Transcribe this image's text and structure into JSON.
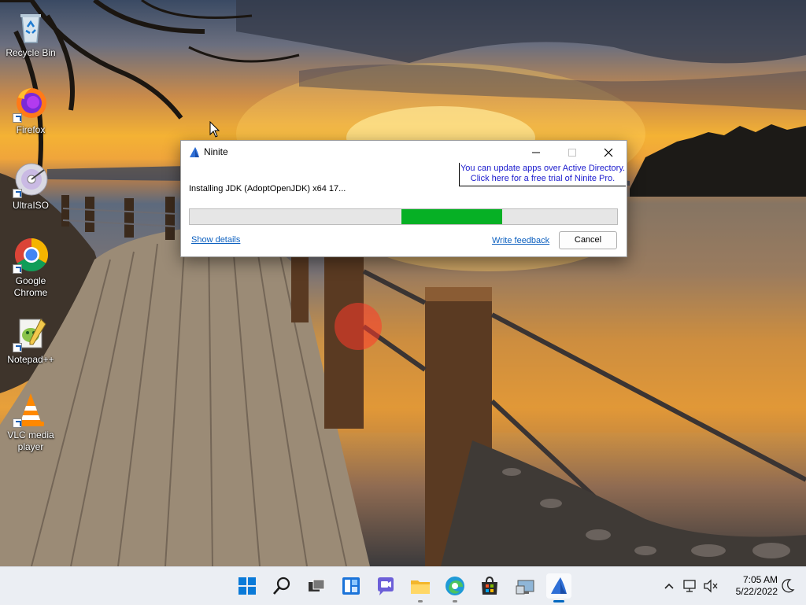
{
  "desktop": {
    "icons": [
      {
        "label": "Recycle Bin",
        "icon": "recycle-bin-icon"
      },
      {
        "label": "Firefox",
        "icon": "firefox-icon"
      },
      {
        "label": "UltraISO",
        "icon": "ultraiso-icon"
      },
      {
        "label": "Google Chrome",
        "icon": "chrome-icon"
      },
      {
        "label": "Notepad++",
        "icon": "notepad-plus-plus-icon"
      },
      {
        "label": "VLC media player",
        "icon": "vlc-icon"
      }
    ]
  },
  "window": {
    "title": "Ninite",
    "icon": "ninite-icon",
    "promo_line1": "You can update apps over Active Directory.",
    "promo_line2": "Click here for a free trial of Ninite Pro.",
    "status": "Installing JDK (AdoptOpenJDK) x64 17...",
    "progress": {
      "start": 0.495,
      "end": 0.73,
      "color": "#06b025"
    },
    "show_details": "Show details",
    "write_feedback": "Write feedback",
    "cancel": "Cancel"
  },
  "taskbar": {
    "apps": [
      "start-icon",
      "search-icon",
      "task-view-icon",
      "widgets-icon",
      "chat-icon",
      "file-explorer-icon",
      "edge-icon",
      "store-icon",
      "remote-desktop-icon",
      "ninite-icon"
    ],
    "active_app": "ninite-icon",
    "time": "7:05 AM",
    "date": "5/22/2022",
    "accent": "#0067c0"
  }
}
